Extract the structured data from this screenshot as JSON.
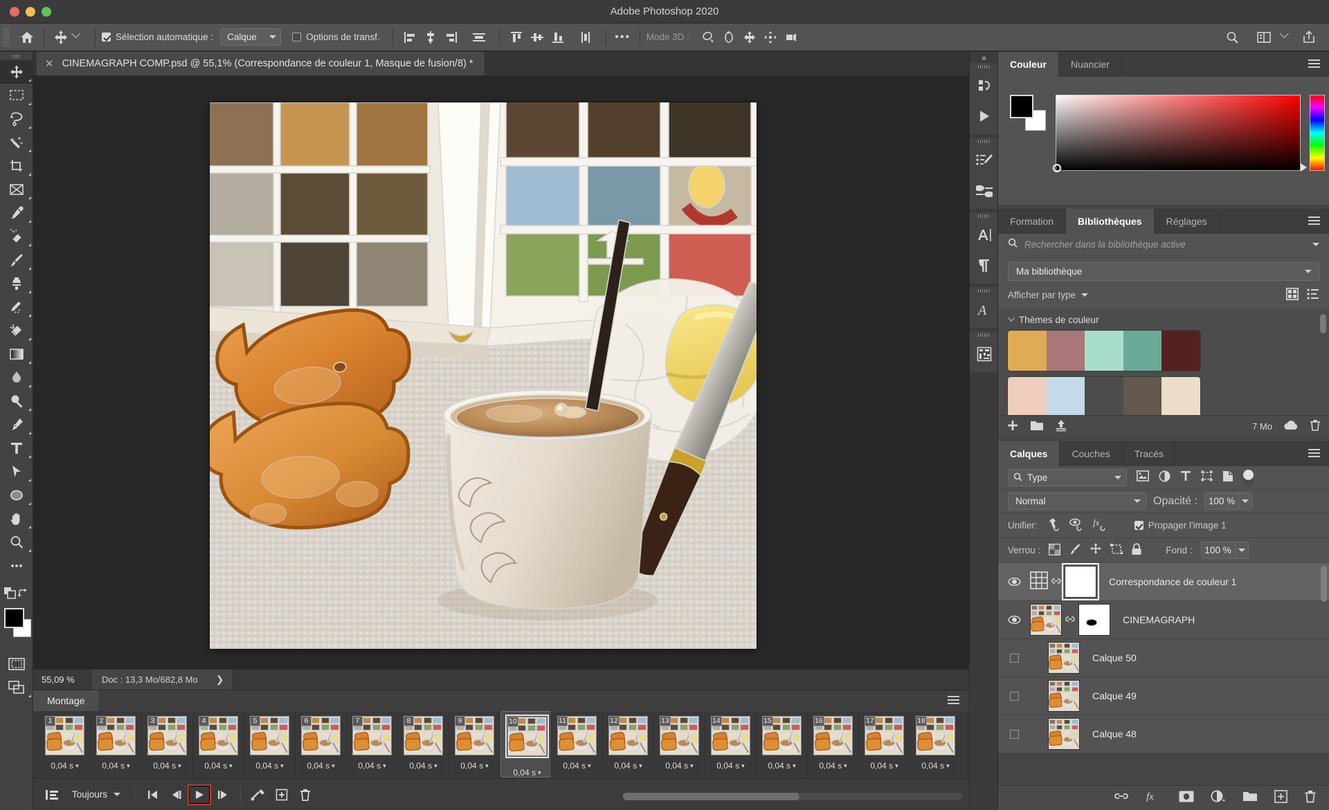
{
  "window": {
    "title": "Adobe Photoshop 2020"
  },
  "options_bar": {
    "home_icon": "home-icon",
    "move_tool_icon": "move-tool-icon",
    "auto_select_label": "Sélection automatique :",
    "auto_select_checked": true,
    "auto_select_value": "Calque",
    "transform_controls_label": "Options de transf.",
    "transform_controls_checked": false,
    "align_icons": [
      "align-left-edges",
      "align-horizontal-centers",
      "align-right-edges",
      "distribute-horizontally"
    ],
    "align_icons2": [
      "align-top-edges",
      "align-vertical-centers",
      "align-bottom-edges",
      "distribute-vertically"
    ],
    "more_label": "•••",
    "mode3d_label": "Mode 3D :",
    "mode3d_icons": [
      "orbit-3d-icon",
      "roll-3d-icon",
      "pan-3d-icon",
      "slide-3d-icon",
      "zoom-3d-camera-icon"
    ],
    "right_icons": [
      "search-icon",
      "workspace-icon",
      "chevron-down-icon",
      "share-icon"
    ]
  },
  "toolbar": {
    "items": [
      {
        "name": "move-tool",
        "active": true
      },
      {
        "name": "rectangular-marquee-tool",
        "active": false
      },
      {
        "name": "lasso-tool",
        "active": false
      },
      {
        "name": "object-selection-tool",
        "active": false
      },
      {
        "name": "crop-tool",
        "active": false
      },
      {
        "name": "frame-tool",
        "active": false
      },
      {
        "name": "eyedropper-tool",
        "active": false
      },
      {
        "name": "spot-healing-brush-tool",
        "active": false
      },
      {
        "name": "brush-tool",
        "active": false
      },
      {
        "name": "clone-stamp-tool",
        "active": false
      },
      {
        "name": "history-brush-tool",
        "active": false
      },
      {
        "name": "eraser-tool",
        "active": false
      },
      {
        "name": "gradient-tool",
        "active": false
      },
      {
        "name": "blur-tool",
        "active": false
      },
      {
        "name": "dodge-tool",
        "active": false
      },
      {
        "name": "pen-tool",
        "active": false
      },
      {
        "name": "type-tool",
        "active": false
      },
      {
        "name": "path-selection-tool",
        "active": false
      },
      {
        "name": "ellipse-tool",
        "active": false
      },
      {
        "name": "hand-tool",
        "active": false
      },
      {
        "name": "zoom-tool",
        "active": false
      },
      {
        "name": "edit-toolbar-tool",
        "active": false
      }
    ],
    "foreground_color": "#000000",
    "background_color": "#ffffff",
    "quick_mask_icon": "quick-mask-icon",
    "screen_mode_icon": "screen-mode-icon"
  },
  "document": {
    "tab_title": "CINEMAGRAPH COMP.psd @ 55,1% (Correspondance de couleur 1, Masque de fusion/8) *",
    "close_icon": "close-icon"
  },
  "status_bar": {
    "zoom": "55,09 %",
    "doc_info": "Doc : 13,3 Mo/682,8 Mo",
    "expand_icon": "chevron-right-icon"
  },
  "timeline": {
    "tab_label": "Montage",
    "menu_icon": "panel-menu-icon",
    "frames": [
      {
        "number": "1",
        "delay": "0,04 s",
        "selected": false
      },
      {
        "number": "2",
        "delay": "0,04 s",
        "selected": false
      },
      {
        "number": "3",
        "delay": "0,04 s",
        "selected": false
      },
      {
        "number": "4",
        "delay": "0,04 s",
        "selected": false
      },
      {
        "number": "5",
        "delay": "0,04 s",
        "selected": false
      },
      {
        "number": "6",
        "delay": "0,04 s",
        "selected": false
      },
      {
        "number": "7",
        "delay": "0,04 s",
        "selected": false
      },
      {
        "number": "8",
        "delay": "0,04 s",
        "selected": false
      },
      {
        "number": "9",
        "delay": "0,04 s",
        "selected": false
      },
      {
        "number": "10",
        "delay": "0,04 s",
        "selected": true
      },
      {
        "number": "11",
        "delay": "0,04 s",
        "selected": false
      },
      {
        "number": "12",
        "delay": "0,04 s",
        "selected": false
      },
      {
        "number": "13",
        "delay": "0,04 s",
        "selected": false
      },
      {
        "number": "14",
        "delay": "0,04 s",
        "selected": false
      },
      {
        "number": "15",
        "delay": "0,04 s",
        "selected": false
      },
      {
        "number": "16",
        "delay": "0,04 s",
        "selected": false
      },
      {
        "number": "17",
        "delay": "0,04 s",
        "selected": false
      },
      {
        "number": "18",
        "delay": "0,04 s",
        "selected": false
      }
    ],
    "convert_icon": "convert-to-video-timeline-icon",
    "loop_value": "Toujours",
    "controls": [
      "select-first-frame-icon",
      "select-previous-frame-icon",
      "play-icon",
      "select-next-frame-icon"
    ],
    "tween_icon": "tween-icon",
    "duplicate_icon": "duplicate-frame-icon",
    "delete_icon": "delete-frame-icon",
    "play_highlight_color": "#c0392b"
  },
  "rail": {
    "groups": [
      [
        "actions-icon",
        "play-actions-icon"
      ],
      [
        "brush-settings-icon",
        "brush-presets-icon"
      ],
      [
        "character-icon",
        "paragraph-icon"
      ],
      [
        "character-styles-icon"
      ],
      [
        "patterns-icon"
      ]
    ],
    "collapse_icon": "collapse-panels-icon"
  },
  "color_panel": {
    "tabs": [
      {
        "label": "Couleur",
        "active": true
      },
      {
        "label": "Nuancier",
        "active": false
      }
    ],
    "menu_icon": "panel-menu-icon",
    "foreground_color": "#000000",
    "background_color": "#ffffff",
    "spectrum_base_hue": "#ff0000"
  },
  "libraries_panel": {
    "tabs": [
      {
        "label": "Formation",
        "active": false
      },
      {
        "label": "Bibliothèques",
        "active": true
      },
      {
        "label": "Réglages",
        "active": false
      }
    ],
    "menu_icon": "panel-menu-icon",
    "search_icon": "search-icon",
    "search_placeholder": "Rechercher dans la bibliothèque active",
    "search_chevron": "chevron-down-icon",
    "library_name": "Ma bibliothèque",
    "filter_label": "Afficher par type",
    "view_grid_icon": "grid-view-icon",
    "view_list_icon": "list-view-icon",
    "section_label": "Thèmes de couleur",
    "color_themes": [
      [
        "#e0ab54",
        "#a9767a",
        "#a8ddcd",
        "#6aa998",
        "#54211f"
      ],
      [
        "#eecdbd",
        "#c4d9ea",
        "#4c4c4c",
        "#63584e",
        "#ebddc8"
      ]
    ],
    "add_icon": "add-content-icon",
    "folder_icon": "new-group-icon",
    "upload_icon": "upload-icon",
    "size_label": "7 Mo",
    "cloud_icon": "cloud-sync-icon",
    "trash_icon": "delete-icon"
  },
  "layers_panel": {
    "tabs": [
      {
        "label": "Calques",
        "active": true
      },
      {
        "label": "Couches",
        "active": false
      },
      {
        "label": "Tracés",
        "active": false
      }
    ],
    "menu_icon": "panel-menu-icon",
    "filter_type_label": "Type",
    "filter_icons": [
      "filter-pixel-icon",
      "filter-adjustment-icon",
      "filter-type-icon",
      "filter-shape-icon",
      "filter-smart-object-icon"
    ],
    "filter_toggle": "filter-enable-toggle",
    "blend_mode": "Normal",
    "opacity_label": "Opacité :",
    "opacity_value": "100 %",
    "unify_label": "Unifier:",
    "unify_icons": [
      "unify-position-icon",
      "unify-visibility-icon",
      "unify-style-icon"
    ],
    "propagate_label": "Propager l'image 1",
    "propagate_checked": true,
    "lock_label": "Verrou :",
    "lock_icons": [
      "lock-transparency-icon",
      "lock-pixels-icon",
      "lock-position-icon",
      "lock-artboard-icon",
      "lock-all-icon"
    ],
    "fill_label": "Fond :",
    "fill_value": "100 %",
    "layers": [
      {
        "name": "Correspondance de couleur 1",
        "visible": true,
        "selected": true,
        "kind": "adjustment",
        "linked": true
      },
      {
        "name": "CINEMAGRAPH",
        "visible": true,
        "selected": false,
        "kind": "pixel-with-mask",
        "linked": true
      },
      {
        "name": "Calque 50",
        "visible": false,
        "selected": false,
        "kind": "pixel",
        "linked": false
      },
      {
        "name": "Calque 49",
        "visible": false,
        "selected": false,
        "kind": "pixel",
        "linked": false
      },
      {
        "name": "Calque 48",
        "visible": false,
        "selected": false,
        "kind": "pixel",
        "linked": false
      }
    ],
    "footer_icons": [
      "link-layers-icon",
      "layer-style-icon",
      "layer-mask-icon",
      "adjustment-layer-icon",
      "new-group-icon",
      "new-layer-icon",
      "delete-layer-icon"
    ]
  }
}
